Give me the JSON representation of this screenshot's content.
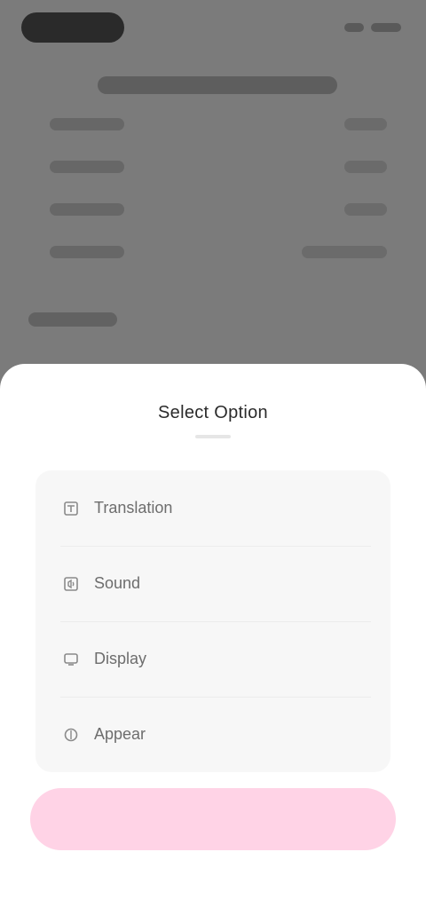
{
  "sheet": {
    "title": "Select Option",
    "options": [
      {
        "label": "Translation",
        "icon": "translate-icon"
      },
      {
        "label": "Sound",
        "icon": "sound-icon"
      },
      {
        "label": "Display",
        "icon": "display-icon"
      },
      {
        "label": "Appear",
        "icon": "appear-icon"
      }
    ],
    "cta_label": "",
    "cta_color": "#ffd3e6"
  }
}
